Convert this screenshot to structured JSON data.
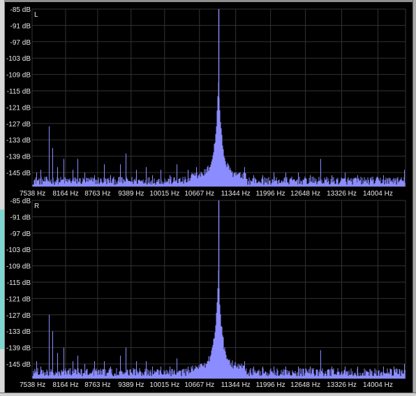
{
  "chart_data": [
    {
      "type": "line",
      "channel_label": "L",
      "xlabel": "",
      "ylabel": "",
      "y_ticks": [
        -85,
        -91,
        -97,
        -103,
        -109,
        -115,
        -121,
        -127,
        -133,
        -139,
        -145
      ],
      "y_tick_labels": [
        "-85 dB",
        "-91 dB",
        "-97 dB",
        "-103 dB",
        "-109 dB",
        "-115 dB",
        "-121 dB",
        "-127 dB",
        "-133 dB",
        "-139 dB",
        "-145 dB"
      ],
      "x_ticks": [
        7538,
        8164,
        8763,
        9389,
        10015,
        10667,
        11344,
        11996,
        12648,
        13326,
        14004
      ],
      "x_tick_labels": [
        "7538 Hz",
        "8164 Hz",
        "8763 Hz",
        "9389 Hz",
        "10015 Hz",
        "10667 Hz",
        "11344 Hz",
        "11996 Hz",
        "12648 Hz",
        "13326 Hz",
        "14004 Hz"
      ],
      "xlim": [
        7538,
        14520
      ],
      "ylim": [
        -151,
        -85
      ],
      "grid": true,
      "peak": {
        "x": 11024,
        "y": -85
      },
      "spurs": [
        {
          "x": 7620,
          "y": -145
        },
        {
          "x": 7700,
          "y": -144
        },
        {
          "x": 7850,
          "y": -128
        },
        {
          "x": 7910,
          "y": -136
        },
        {
          "x": 8010,
          "y": -143
        },
        {
          "x": 8130,
          "y": -140
        },
        {
          "x": 8300,
          "y": -144
        },
        {
          "x": 8390,
          "y": -140
        },
        {
          "x": 8520,
          "y": -145
        },
        {
          "x": 8700,
          "y": -146
        },
        {
          "x": 8880,
          "y": -142
        },
        {
          "x": 9000,
          "y": -146
        },
        {
          "x": 9180,
          "y": -142
        },
        {
          "x": 9290,
          "y": -138
        },
        {
          "x": 9480,
          "y": -144
        },
        {
          "x": 9660,
          "y": -143
        },
        {
          "x": 9780,
          "y": -146
        },
        {
          "x": 9940,
          "y": -144
        },
        {
          "x": 10110,
          "y": -146
        },
        {
          "x": 10240,
          "y": -142
        },
        {
          "x": 10450,
          "y": -144
        },
        {
          "x": 10600,
          "y": -143
        },
        {
          "x": 11500,
          "y": -143
        },
        {
          "x": 11680,
          "y": -146
        },
        {
          "x": 11850,
          "y": -146
        },
        {
          "x": 12050,
          "y": -145
        },
        {
          "x": 12270,
          "y": -145
        },
        {
          "x": 12510,
          "y": -145
        },
        {
          "x": 12730,
          "y": -146
        },
        {
          "x": 12930,
          "y": -140
        },
        {
          "x": 13140,
          "y": -146
        },
        {
          "x": 13380,
          "y": -145
        },
        {
          "x": 13620,
          "y": -146
        },
        {
          "x": 13860,
          "y": -147
        },
        {
          "x": 14100,
          "y": -146
        },
        {
          "x": 14300,
          "y": -147
        },
        {
          "x": 14500,
          "y": -144
        }
      ]
    },
    {
      "type": "line",
      "channel_label": "R",
      "xlabel": "",
      "ylabel": "",
      "y_ticks": [
        -85,
        -91,
        -97,
        -103,
        -109,
        -115,
        -121,
        -127,
        -133,
        -139,
        -145
      ],
      "y_tick_labels": [
        "-85 dB",
        "-91 dB",
        "-97 dB",
        "-103 dB",
        "-109 dB",
        "-115 dB",
        "-121 dB",
        "-127 dB",
        "-133 dB",
        "-139 dB",
        "-145 dB"
      ],
      "x_ticks": [
        7538,
        8164,
        8763,
        9389,
        10015,
        10667,
        11344,
        11996,
        12648,
        13326,
        14004
      ],
      "x_tick_labels": [
        "7538 Hz",
        "8164 Hz",
        "8763 Hz",
        "9389 Hz",
        "10015 Hz",
        "10667 Hz",
        "11344 Hz",
        "11996 Hz",
        "12648 Hz",
        "13326 Hz",
        "14004 Hz"
      ],
      "xlim": [
        7538,
        14520
      ],
      "ylim": [
        -151,
        -85
      ],
      "grid": true,
      "peak": {
        "x": 11024,
        "y": -85
      },
      "spurs": [
        {
          "x": 7620,
          "y": -144
        },
        {
          "x": 7700,
          "y": -146
        },
        {
          "x": 7850,
          "y": -127
        },
        {
          "x": 7910,
          "y": -133
        },
        {
          "x": 8010,
          "y": -141
        },
        {
          "x": 8130,
          "y": -139
        },
        {
          "x": 8300,
          "y": -144
        },
        {
          "x": 8390,
          "y": -142
        },
        {
          "x": 8520,
          "y": -145
        },
        {
          "x": 8700,
          "y": -144
        },
        {
          "x": 8880,
          "y": -144
        },
        {
          "x": 9000,
          "y": -146
        },
        {
          "x": 9180,
          "y": -142
        },
        {
          "x": 9290,
          "y": -139
        },
        {
          "x": 9480,
          "y": -144
        },
        {
          "x": 9660,
          "y": -144
        },
        {
          "x": 9780,
          "y": -146
        },
        {
          "x": 9940,
          "y": -146
        },
        {
          "x": 10110,
          "y": -146
        },
        {
          "x": 10240,
          "y": -143
        },
        {
          "x": 10450,
          "y": -146
        },
        {
          "x": 10600,
          "y": -146
        },
        {
          "x": 11500,
          "y": -144
        },
        {
          "x": 11680,
          "y": -146
        },
        {
          "x": 11850,
          "y": -146
        },
        {
          "x": 12050,
          "y": -146
        },
        {
          "x": 12270,
          "y": -146
        },
        {
          "x": 12510,
          "y": -146
        },
        {
          "x": 12730,
          "y": -146
        },
        {
          "x": 12930,
          "y": -140
        },
        {
          "x": 13140,
          "y": -146
        },
        {
          "x": 13380,
          "y": -146
        },
        {
          "x": 13620,
          "y": -146
        },
        {
          "x": 13860,
          "y": -147
        },
        {
          "x": 14100,
          "y": -146
        },
        {
          "x": 14300,
          "y": -146
        },
        {
          "x": 14500,
          "y": -145
        }
      ]
    }
  ],
  "colors": {
    "background": "#000000",
    "grid": "#333333",
    "trace": "#8a8cff",
    "text": "#e8e8e8"
  }
}
